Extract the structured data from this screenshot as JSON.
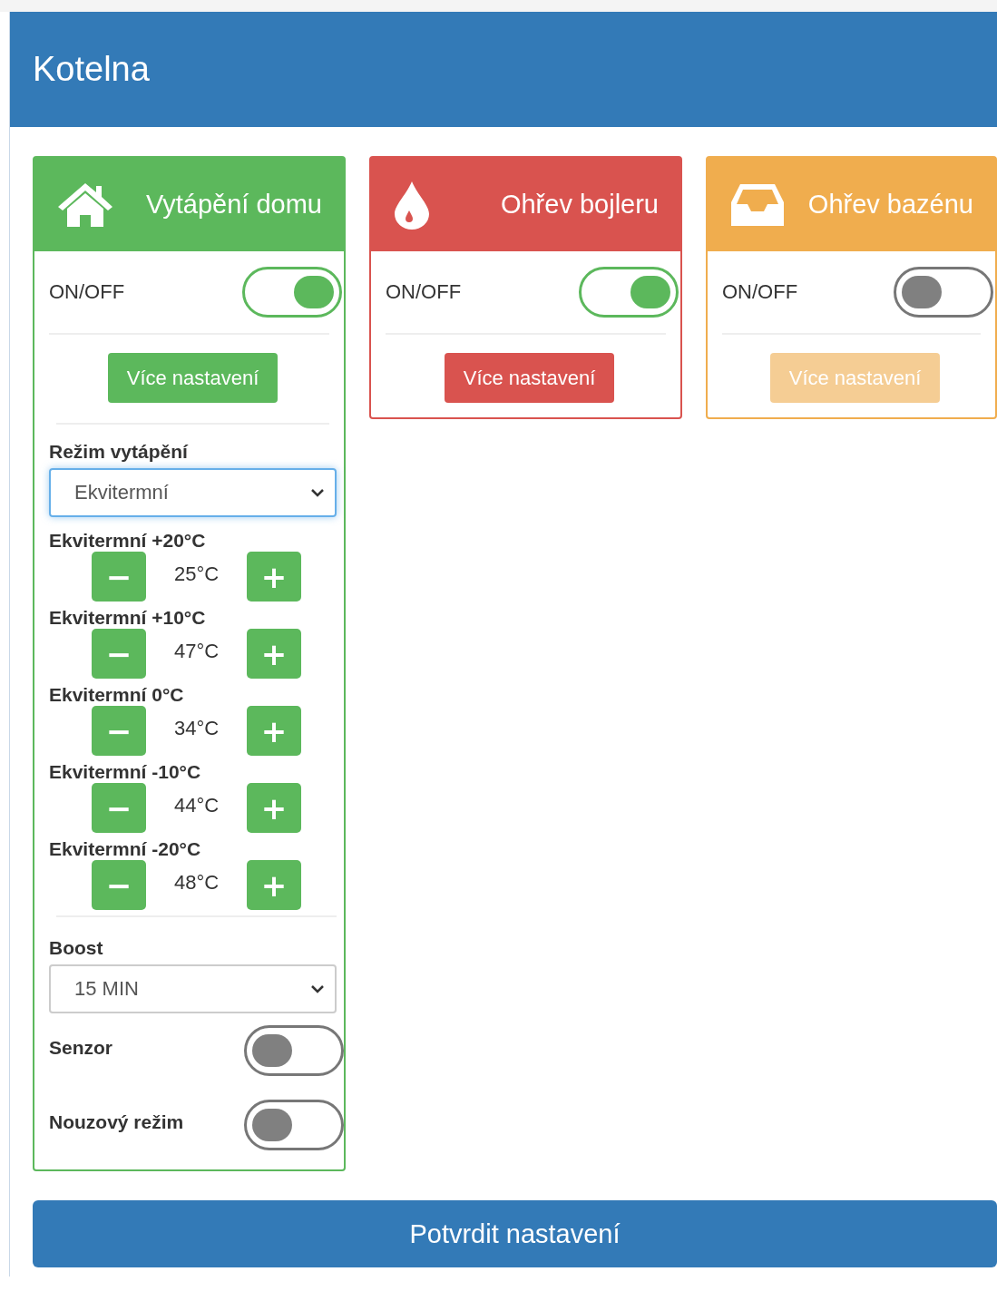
{
  "header": {
    "title": "Kotelna"
  },
  "cards": [
    {
      "kind": "house",
      "title": "Vytápění domu",
      "color": "#5cb85c",
      "switch_label": "ON/OFF",
      "on": true,
      "button": {
        "label": "Více nastavení",
        "disabled": false
      },
      "settings": {
        "mode_label": "Režim vytápění",
        "mode_value": "Ekvitermní",
        "mode_focused": true,
        "curve": [
          {
            "label": "Ekvitermní +20°C",
            "minus": "−",
            "value": "25°C",
            "plus": "+"
          },
          {
            "label": "Ekvitermní +10°C",
            "minus": "−",
            "value": "47°C",
            "plus": "+"
          },
          {
            "label": "Ekvitermní 0°C",
            "minus": "−",
            "value": "34°C",
            "plus": "+"
          },
          {
            "label": "Ekvitermní -10°C",
            "minus": "−",
            "value": "44°C",
            "plus": "+"
          },
          {
            "label": "Ekvitermní -20°C",
            "minus": "−",
            "value": "48°C",
            "plus": "+"
          }
        ],
        "boost_label": "Boost",
        "boost_value": "15 MIN",
        "switches": [
          {
            "label": "Senzor",
            "on": false
          },
          {
            "label": "Nouzový režim",
            "on": false
          }
        ]
      }
    },
    {
      "kind": "drop",
      "title": "Ohřev bojleru",
      "color": "#d9534f",
      "switch_label": "ON/OFF",
      "on": true,
      "button": {
        "label": "Více nastavení",
        "disabled": false
      }
    },
    {
      "kind": "tray",
      "title": "Ohřev bazénu",
      "color": "#f0ad4e",
      "switch_label": "ON/OFF",
      "on": false,
      "button": {
        "label": "Více nastavení",
        "disabled": true
      }
    }
  ],
  "confirm": {
    "label": "Potvrdit nastavení"
  }
}
